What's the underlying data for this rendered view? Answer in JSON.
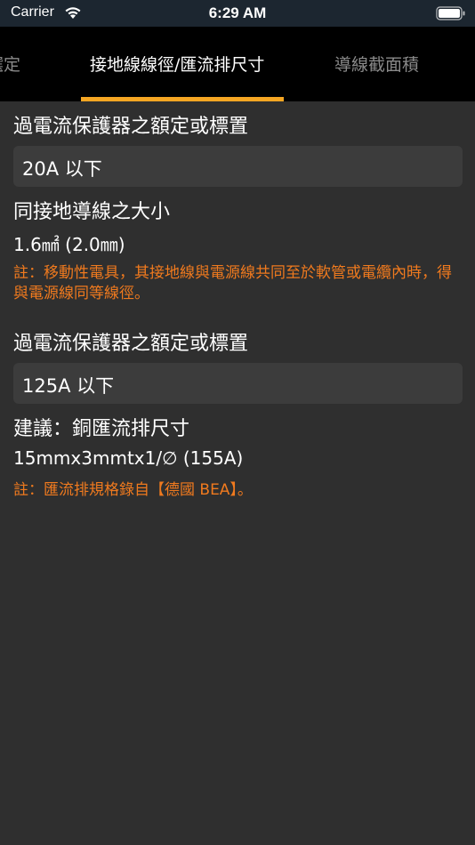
{
  "status_bar": {
    "carrier": "Carrier",
    "time": "6:29 AM"
  },
  "tabs": [
    {
      "label": "徑選定",
      "active": false
    },
    {
      "label": "接地線線徑/匯流排尺寸",
      "active": true
    },
    {
      "label": "導線截面積",
      "active": false
    }
  ],
  "colors": {
    "accent": "#f5a623",
    "note": "#f07a1e",
    "background": "#2f2f2f",
    "field": "#3c3c3c"
  },
  "section1": {
    "heading": "過電流保護器之額定或標置",
    "selected": "20A 以下",
    "result_label": "同接地導線之大小",
    "result_value": "1.6㎟ (2.0㎜)",
    "note": "註：移動性電具，其接地線與電源線共同至於軟管或電纜內時，得與電源線同等線徑。"
  },
  "section2": {
    "heading": "過電流保護器之額定或標置",
    "selected": "125A 以下",
    "result_label": "建議：銅匯流排尺寸",
    "result_value": "15mmx3mmtx1/∅ (155A)",
    "note": "註：匯流排規格錄自【德國 BEA】。"
  }
}
